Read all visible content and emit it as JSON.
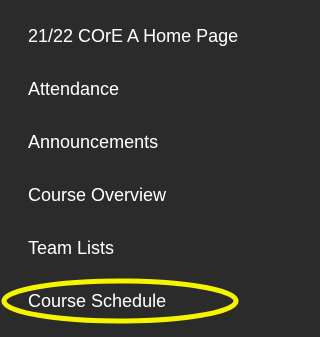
{
  "menu": {
    "items": [
      {
        "label": "21/22 COrE A Home Page"
      },
      {
        "label": "Attendance"
      },
      {
        "label": "Announcements"
      },
      {
        "label": "Course Overview"
      },
      {
        "label": "Team Lists"
      },
      {
        "label": "Course Schedule"
      }
    ]
  },
  "colors": {
    "background": "#2b2b2b",
    "text": "#ffffff",
    "highlight": "#f5f500"
  }
}
